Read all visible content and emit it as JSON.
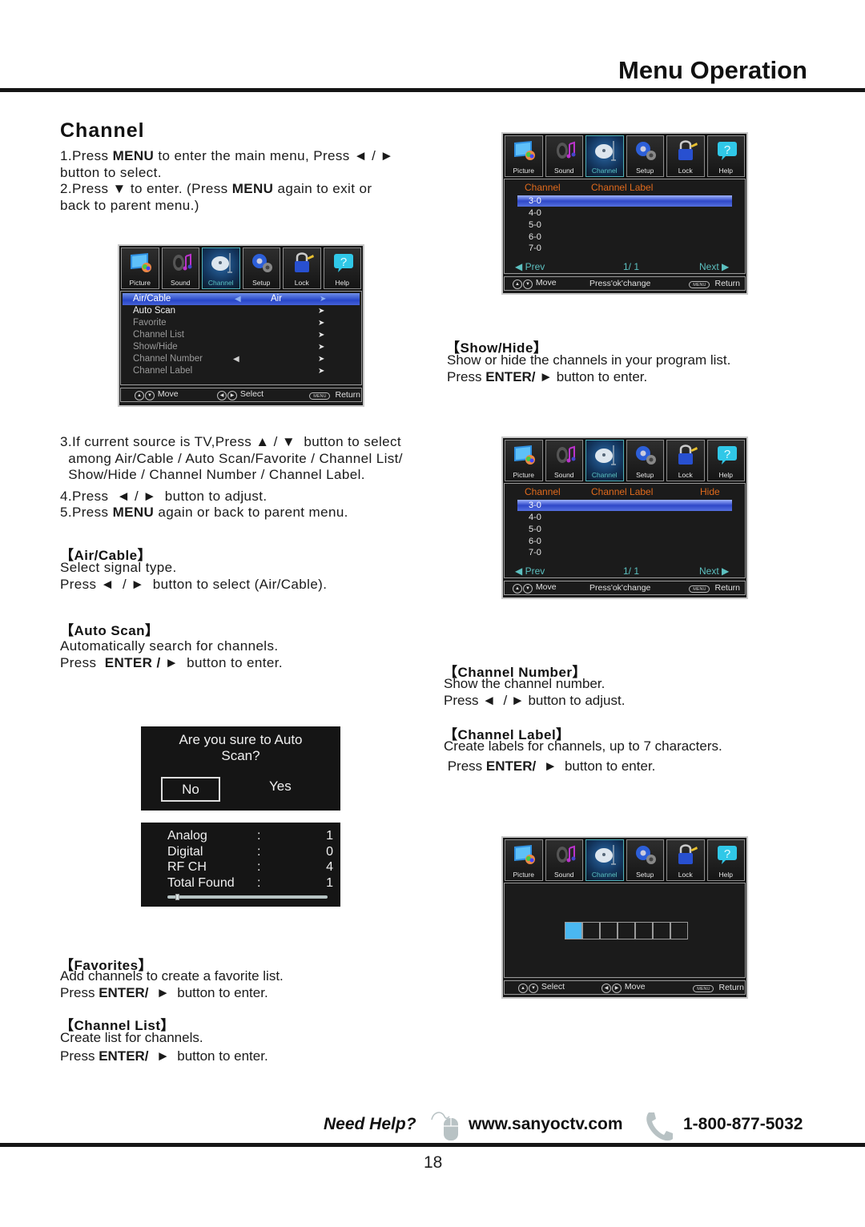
{
  "header": {
    "title": "Menu Operation"
  },
  "section": {
    "title": "Channel"
  },
  "steps_top": [
    {
      "pre": "1.Press ",
      "bold": "MENU",
      "post": " to enter the main menu, Press ◄ / ►"
    },
    {
      "pre": "button to select.",
      "bold": "",
      "post": ""
    },
    {
      "pre": "2.Press ▼ to enter. (Press ",
      "bold": "MENU",
      "post": " again to exit or"
    },
    {
      "pre": " back to parent menu.)",
      "bold": "",
      "post": ""
    }
  ],
  "steps_mid": [
    {
      "pre": "3.If current source is TV,Press ▲ / ▼  button to select",
      "bold": "",
      "post": ""
    },
    {
      "pre": "  among Air/Cable / Auto Scan/Favorite / Channel List/",
      "bold": "",
      "post": ""
    },
    {
      "pre": "  Show/Hide / Channel Number / Channel Label.",
      "bold": "",
      "post": ""
    },
    {
      "pre": "4.Press  ◄ / ►  button to adjust.",
      "bold": "",
      "post": ""
    },
    {
      "pre": "5.Press ",
      "bold": "MENU",
      "post": " again or back to parent menu."
    }
  ],
  "osd_tabs": [
    {
      "label": "Picture",
      "icon": "picture-icon"
    },
    {
      "label": "Sound",
      "icon": "sound-icon"
    },
    {
      "label": "Channel",
      "icon": "channel-icon",
      "active": true
    },
    {
      "label": "Setup",
      "icon": "setup-icon"
    },
    {
      "label": "Lock",
      "icon": "lock-icon"
    },
    {
      "label": "Help",
      "icon": "help-icon"
    }
  ],
  "channel_menu": {
    "items": [
      {
        "label": "Air/Cable",
        "value": "Air",
        "state": "selected"
      },
      {
        "label": "Auto Scan",
        "state": "enabled"
      },
      {
        "label": "Favorite",
        "state": "disabled"
      },
      {
        "label": "Channel List",
        "state": "disabled"
      },
      {
        "label": "Show/Hide",
        "state": "disabled"
      },
      {
        "label": "Channel Number",
        "state": "disabled"
      },
      {
        "label": "Channel Label",
        "state": "disabled"
      }
    ],
    "footer": {
      "move": "Move",
      "select": "Select",
      "menu_key": "MENU",
      "return": "Return"
    }
  },
  "channel_list_osd": {
    "col_channel": "Channel",
    "col_label": "Channel Label",
    "rows": [
      "3-0",
      "4-0",
      "5-0",
      "6-0",
      "7-0"
    ],
    "prev": "Prev",
    "page": "1/ 1",
    "next": "Next",
    "footer": {
      "move": "Move",
      "change": "Press'ok'change",
      "menu_key": "MENU",
      "return": "Return"
    }
  },
  "show_hide_osd": {
    "col_channel": "Channel",
    "col_label": "Channel Label",
    "col_hide": "Hide",
    "rows": [
      "3-0",
      "4-0",
      "5-0",
      "6-0",
      "7-0"
    ],
    "prev": "Prev",
    "page": "1/ 1",
    "next": "Next",
    "footer": {
      "move": "Move",
      "change": "Press'ok'change",
      "menu_key": "MENU",
      "return": "Return"
    }
  },
  "label_osd": {
    "box_count": 7,
    "active_index": 0,
    "footer": {
      "select": "Select",
      "move": "Move",
      "menu_key": "MENU",
      "return": "Return"
    }
  },
  "show_hide": {
    "heading": "【Show/Hide】",
    "line1": "Show or hide the  channels in your program list.",
    "line2_pre": "Press ",
    "line2_bold": "ENTER/",
    "line2_post": " ►  button to enter."
  },
  "air_cable": {
    "heading": "【Air/Cable】",
    "line1": "Select signal type.",
    "line2": "Press ◄  / ►  button to select (Air/Cable)."
  },
  "auto_scan": {
    "heading": "【Auto Scan】",
    "line1": "Automatically search for channels.",
    "line2_pre": "Press  ",
    "line2_bold": "ENTER / ►",
    "line2_post": "  button to enter."
  },
  "channel_number": {
    "heading": "【Channel Number】",
    "line1": "Show the channel number.",
    "line2": "Press ◄  / ► button to adjust."
  },
  "channel_label": {
    "heading": "【Channel Label】",
    "line1": "Create labels for channels, up to 7 characters.",
    "line2_pre": " Press ",
    "line2_bold": "ENTER/",
    "line2_post": "  ►  button to enter."
  },
  "confirm_dialog": {
    "question_line1": "Are you sure to Auto",
    "question_line2": "Scan?",
    "no": "No",
    "yes": "Yes"
  },
  "scan_result": {
    "rows": [
      {
        "label": "Analog",
        "value": "1"
      },
      {
        "label": "Digital",
        "value": "0"
      },
      {
        "label": "RF CH",
        "value": "4"
      },
      {
        "label": "Total Found",
        "value": "1"
      }
    ],
    "progress_fraction": 0.05
  },
  "favorites": {
    "heading": "【Favorites】",
    "line1": "Add channels to create a favorite list.",
    "line2_pre": "Press ",
    "line2_bold": "ENTER/",
    "line2_post": "  ►  button to enter."
  },
  "channel_list": {
    "heading": "【Channel List】",
    "line1": "Create list for channels.",
    "line2_pre": "Press ",
    "line2_bold": "ENTER/",
    "line2_post": "  ►  button to enter."
  },
  "footer": {
    "need_help": "Need Help?",
    "website": "www.sanyoctv.com",
    "phone": "1-800-877-5032",
    "page_number": "18"
  },
  "colors": {
    "osd_header_orange": "#e06a1c",
    "osd_pager_teal": "#5cc0c0",
    "osd_selection_blue": "#2746c8",
    "label_cursor_blue": "#4ab7f0"
  }
}
